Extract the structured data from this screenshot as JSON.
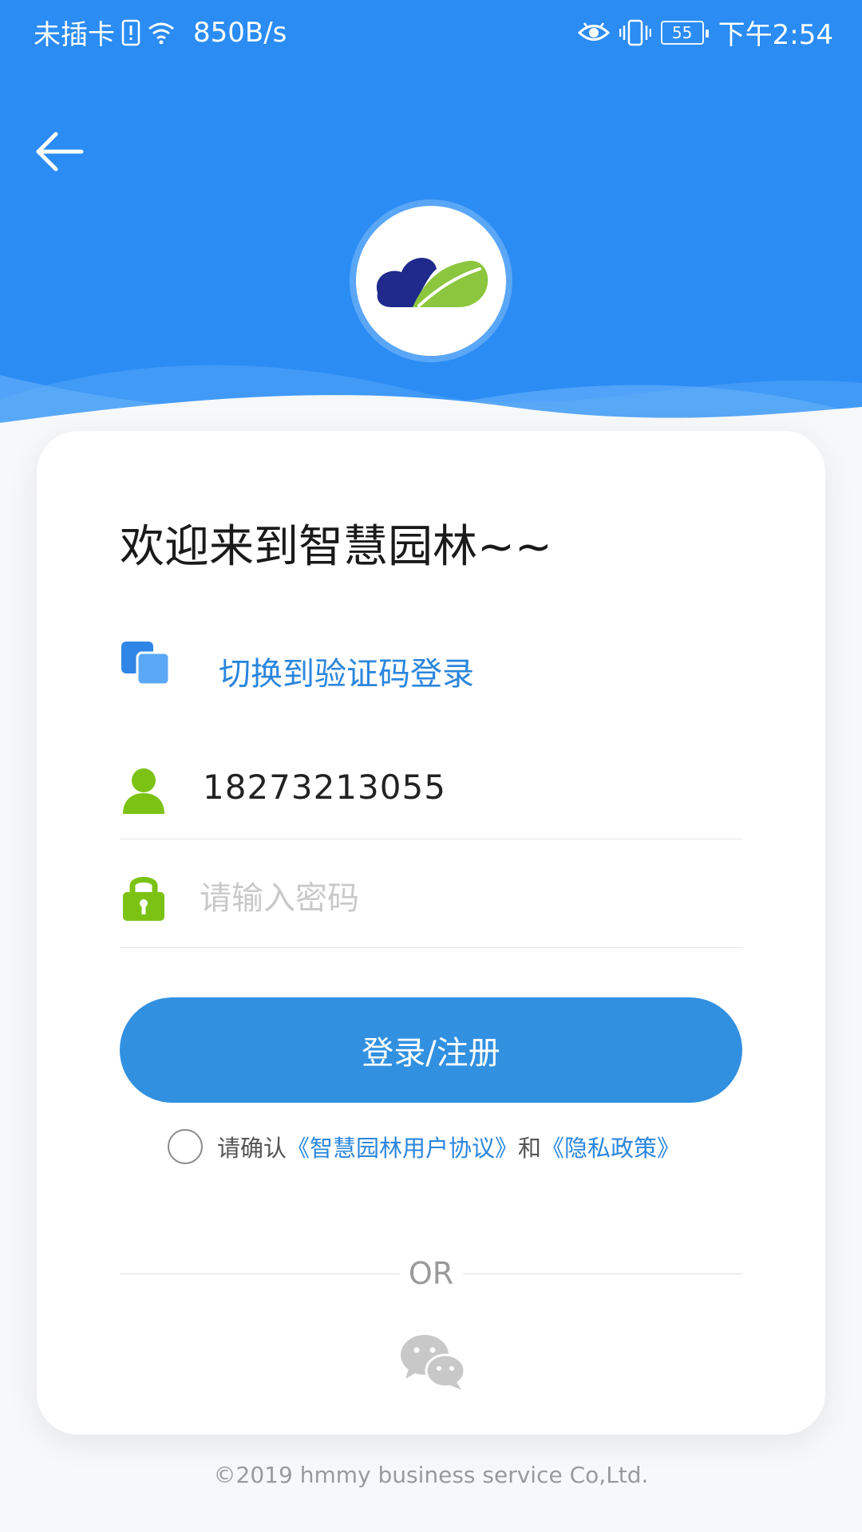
{
  "status_bar": {
    "carrier": "未插卡",
    "speed": "850B/s",
    "battery": "55",
    "time": "下午2:54",
    "icons": [
      "sim-alert-icon",
      "wifi-icon",
      "eye-icon",
      "vibrate-icon",
      "battery-icon"
    ]
  },
  "header": {
    "back_icon": "arrow-left-icon",
    "logo": "cloud-leaf-logo"
  },
  "login": {
    "welcome": "欢迎来到智慧园林~~",
    "switch_label": "切换到验证码登录",
    "phone_value": "18273213055",
    "password_placeholder": "请输入密码",
    "submit_label": "登录/注册",
    "agree_prefix": "请确认",
    "agreement_link": "《智慧园林用户协议》",
    "agree_and": "和",
    "privacy_link": "《隐私政策》",
    "or_label": "OR"
  },
  "footer": {
    "copyright": "©2019 hmmy business service Co,Ltd."
  },
  "colors": {
    "header_blue": "#2b8cf4",
    "button_blue": "#3290e0",
    "link_blue": "#2b86dd",
    "icon_green": "#7cc215",
    "logo_navy": "#1f2a8c",
    "logo_green": "#8cc63f"
  }
}
